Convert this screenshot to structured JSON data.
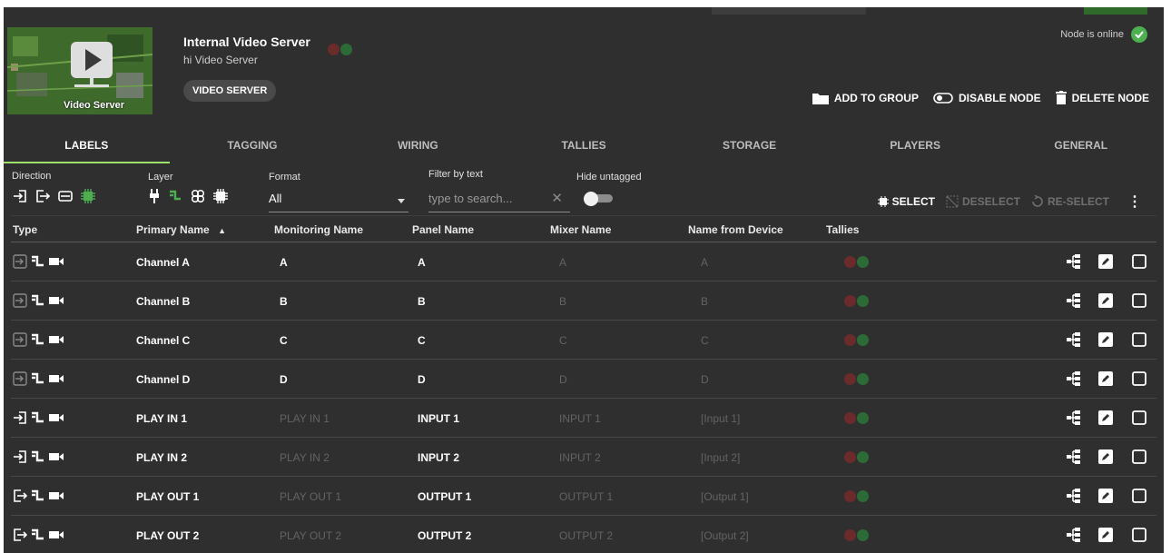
{
  "node": {
    "thumb_label": "Video Server",
    "title": "Internal Video Server",
    "subtitle": "hi Video Server",
    "type_chip": "VIDEO SERVER",
    "online_text": "Node is online",
    "actions": [
      "ADD TO GROUP",
      "DISABLE NODE",
      "DELETE NODE"
    ]
  },
  "tabs": [
    "LABELS",
    "TAGGING",
    "WIRING",
    "TALLIES",
    "STORAGE",
    "PLAYERS",
    "GENERAL"
  ],
  "filters": {
    "direction_label": "Direction",
    "layer_label": "Layer",
    "format_label": "Format",
    "format_value": "All",
    "filter_label": "Filter by text",
    "search_placeholder": "type to search...",
    "hide_untagged_label": "Hide untagged",
    "select_label": "SELECT",
    "deselect_label": "DESELECT",
    "reselect_label": "RE-SELECT"
  },
  "columns": [
    "Type",
    "Primary Name",
    "Monitoring Name",
    "Panel Name",
    "Mixer Name",
    "Name from Device",
    "Tallies"
  ],
  "rows": [
    {
      "dir": "in-dim",
      "primary": "Channel A",
      "monitoring": "A",
      "monitoring_dim": false,
      "panel": "A",
      "mixer": "A",
      "device": "A"
    },
    {
      "dir": "in-dim",
      "primary": "Channel B",
      "monitoring": "B",
      "monitoring_dim": false,
      "panel": "B",
      "mixer": "B",
      "device": "B"
    },
    {
      "dir": "in-dim",
      "primary": "Channel C",
      "monitoring": "C",
      "monitoring_dim": false,
      "panel": "C",
      "mixer": "C",
      "device": "C"
    },
    {
      "dir": "in-dim",
      "primary": "Channel D",
      "monitoring": "D",
      "monitoring_dim": false,
      "panel": "D",
      "mixer": "D",
      "device": "D"
    },
    {
      "dir": "in",
      "primary": "PLAY IN 1",
      "monitoring": "PLAY IN 1",
      "monitoring_dim": true,
      "panel": "INPUT 1",
      "mixer": "INPUT 1",
      "device": "[Input 1]"
    },
    {
      "dir": "in",
      "primary": "PLAY IN 2",
      "monitoring": "PLAY IN 2",
      "monitoring_dim": true,
      "panel": "INPUT 2",
      "mixer": "INPUT 2",
      "device": "[Input 2]"
    },
    {
      "dir": "out",
      "primary": "PLAY OUT 1",
      "monitoring": "PLAY OUT 1",
      "monitoring_dim": true,
      "panel": "OUTPUT 1",
      "mixer": "OUTPUT 1",
      "device": "[Output 1]"
    },
    {
      "dir": "out",
      "primary": "PLAY OUT 2",
      "monitoring": "PLAY OUT 2",
      "monitoring_dim": true,
      "panel": "OUTPUT 2",
      "mixer": "OUTPUT 2",
      "device": "[Output 2]"
    }
  ],
  "colors": {
    "accent_green": "#4caf50",
    "tab_underline": "#9fe06b",
    "tally_red": "#6b2b2b",
    "tally_green": "#2c6b36"
  }
}
